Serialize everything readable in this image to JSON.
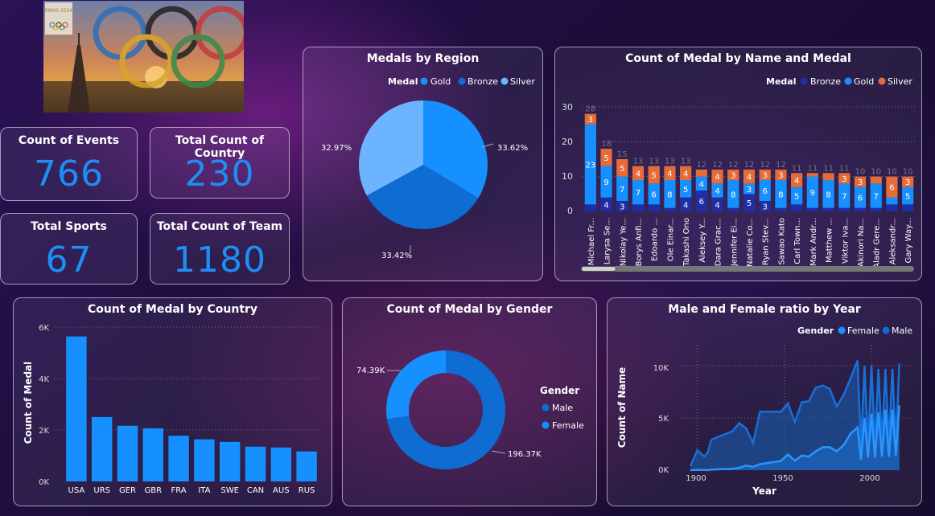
{
  "kpis": {
    "events": {
      "label": "Count of Events",
      "value": "766"
    },
    "countries": {
      "label": "Total Count of Country",
      "value": "230"
    },
    "sports": {
      "label": "Total Sports",
      "value": "67"
    },
    "teams": {
      "label": "Total Count of Team",
      "value": "1180"
    }
  },
  "region_chart": {
    "title": "Medals by Region",
    "legend_title": "Medal",
    "legend": [
      "Gold",
      "Bronze",
      "Silver"
    ],
    "colors": {
      "Gold": "#1690ff",
      "Bronze": "#0f6cd2",
      "Silver": "#6cb4ff"
    },
    "labels": {
      "gold": "33.62%",
      "bronze": "33.42%",
      "silver": "32.97%"
    }
  },
  "name_chart": {
    "title": "Count of Medal by Name and Medal",
    "legend_title": "Medal",
    "legend": [
      "Bronze",
      "Gold",
      "Silver"
    ],
    "colors": {
      "Bronze": "#1f2fa3",
      "Gold": "#1690ff",
      "Silver": "#e66c37"
    },
    "y_ticks": [
      "30",
      "20",
      "10",
      "0"
    ]
  },
  "country_chart": {
    "title": "Count of Medal by Country",
    "ylabel": "Count of Medal",
    "y_ticks": [
      "6K",
      "4K",
      "2K",
      "0K"
    ]
  },
  "gender_chart": {
    "title": "Count of Medal by Gender",
    "legend_title": "Gender",
    "legend": [
      "Male",
      "Female"
    ],
    "colors": {
      "Male": "#0f6cd2",
      "Female": "#1690ff"
    },
    "labels": {
      "female": "74.39K",
      "male": "196.37K"
    }
  },
  "ratio_chart": {
    "title": "Male and Female ratio by Year",
    "legend_title": "Gender",
    "legend": [
      "Female",
      "Male"
    ],
    "colors": {
      "Female": "#1690ff",
      "Male": "#0f6cd2"
    },
    "ylabel": "Count of Name",
    "xlabel": "Year",
    "y_ticks": [
      "10K",
      "5K",
      "0K"
    ],
    "x_ticks": [
      "1900",
      "1950",
      "2000"
    ]
  },
  "logo": {
    "text": "PARIS 2024"
  },
  "chart_data": [
    {
      "type": "pie",
      "title": "Medals by Region",
      "categories": [
        "Gold",
        "Bronze",
        "Silver"
      ],
      "values": [
        33.62,
        33.42,
        32.97
      ]
    },
    {
      "type": "bar",
      "title": "Count of Medal by Name and Medal",
      "categories": [
        "Michael Fr...",
        "Larysa Se...",
        "Nikolay Ye...",
        "Borys Anfi...",
        "Edoardo ...",
        "Ole Einar...",
        "Takashi Ono",
        "Aleksey Y...",
        "Dara Grac...",
        "Jennifer Ei...",
        "Natalie Co...",
        "Ryan Stev...",
        "Sawao Kato",
        "Carl Town...",
        "Mark Andr...",
        "Matthew ...",
        "Viktor Iva...",
        "Akinori Na...",
        "Aladr Gere...",
        "Aleksandr...",
        "Gary Way..."
      ],
      "series": [
        {
          "name": "Bronze",
          "values": [
            2,
            4,
            3,
            2,
            2,
            1,
            4,
            6,
            4,
            1,
            5,
            3,
            1,
            2,
            1,
            1,
            1,
            1,
            1,
            2,
            2
          ]
        },
        {
          "name": "Gold",
          "values": [
            23,
            9,
            7,
            7,
            6,
            8,
            5,
            4,
            4,
            8,
            3,
            6,
            8,
            5,
            9,
            8,
            7,
            6,
            7,
            2,
            5
          ]
        },
        {
          "name": "Silver",
          "values": [
            3,
            5,
            5,
            4,
            5,
            4,
            4,
            2,
            4,
            3,
            4,
            3,
            3,
            4,
            1,
            2,
            3,
            3,
            2,
            6,
            3
          ]
        }
      ],
      "totals": [
        28,
        18,
        15,
        13,
        13,
        13,
        13,
        12,
        12,
        12,
        12,
        12,
        12,
        11,
        11,
        11,
        11,
        10,
        10,
        10,
        10
      ],
      "ylim": [
        0,
        30
      ]
    },
    {
      "type": "bar",
      "title": "Count of Medal by Country",
      "categories": [
        "USA",
        "URS",
        "GER",
        "GBR",
        "FRA",
        "ITA",
        "SWE",
        "CAN",
        "AUS",
        "RUS"
      ],
      "values": [
        5637,
        2503,
        2165,
        2068,
        1777,
        1637,
        1536,
        1352,
        1320,
        1165
      ],
      "ylabel": "Count of Medal",
      "ylim": [
        0,
        6000
      ]
    },
    {
      "type": "pie",
      "title": "Count of Medal by Gender",
      "categories": [
        "Male",
        "Female"
      ],
      "values": [
        196370,
        74390
      ]
    },
    {
      "type": "area",
      "title": "Male and Female ratio by Year",
      "xlabel": "Year",
      "ylabel": "Count of Name",
      "ylim": [
        0,
        12000
      ],
      "series": [
        {
          "name": "Male",
          "x": [
            1896,
            1900,
            1904,
            1906,
            1908,
            1912,
            1920,
            1924,
            1928,
            1932,
            1936,
            1948,
            1952,
            1956,
            1960,
            1964,
            1968,
            1972,
            1976,
            1980,
            1984,
            1988,
            1992,
            1994,
            1996,
            1998,
            2000,
            2002,
            2004,
            2006,
            2008,
            2010,
            2012,
            2014,
            2016
          ],
          "values": [
            380,
            1900,
            1300,
            1700,
            2900,
            3200,
            3700,
            4500,
            4000,
            2600,
            5600,
            5600,
            6400,
            4600,
            6500,
            6600,
            7900,
            8100,
            7800,
            6100,
            7200,
            8800,
            10500,
            2200,
            10000,
            2300,
            10000,
            2500,
            9700,
            2500,
            9700,
            2500,
            9700,
            2600,
            10200
          ]
        },
        {
          "name": "Female",
          "x": [
            1896,
            1900,
            1904,
            1906,
            1908,
            1912,
            1920,
            1924,
            1928,
            1932,
            1936,
            1948,
            1952,
            1956,
            1960,
            1964,
            1968,
            1972,
            1976,
            1980,
            1984,
            1988,
            1992,
            1994,
            1996,
            1998,
            2000,
            2002,
            2004,
            2006,
            2008,
            2010,
            2012,
            2014,
            2016
          ],
          "values": [
            0,
            30,
            20,
            10,
            60,
            90,
            130,
            230,
            440,
            330,
            580,
            890,
            1500,
            900,
            1400,
            1300,
            1800,
            2200,
            2200,
            1800,
            2400,
            3500,
            4100,
            1000,
            5000,
            1200,
            5400,
            1200,
            5500,
            1300,
            5800,
            1300,
            5800,
            1400,
            6200
          ]
        }
      ]
    }
  ]
}
